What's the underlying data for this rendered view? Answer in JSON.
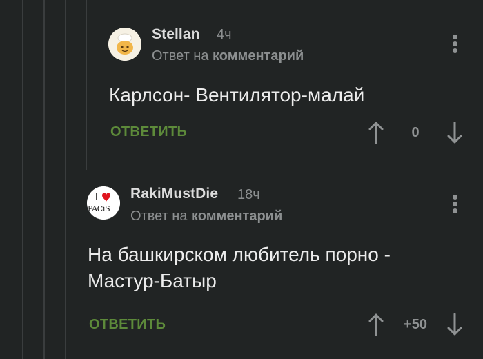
{
  "comments": [
    {
      "author": "Stellan",
      "time": "4ч",
      "reply_prefix": "Ответ на",
      "reply_target": "комментарий",
      "body": "Карлсон- Вентилятор-малай",
      "reply_label": "ОТВЕТИТЬ",
      "score": "0"
    },
    {
      "author": "RakiMustDie",
      "time": "18ч",
      "reply_prefix": "Ответ на",
      "reply_target": "комментарий",
      "body_line1": "На башкирском любитель порно -",
      "body_line2": "Мастур-Батыр",
      "reply_label": "ОТВЕТИТЬ",
      "score": "+50",
      "avatar_text_top": "I",
      "avatar_text_bottom": "PACiS"
    }
  ],
  "colors": {
    "background": "#212424",
    "reply_green": "#5d8a3a",
    "muted": "#8c8f90",
    "heart": "#e0141e"
  }
}
